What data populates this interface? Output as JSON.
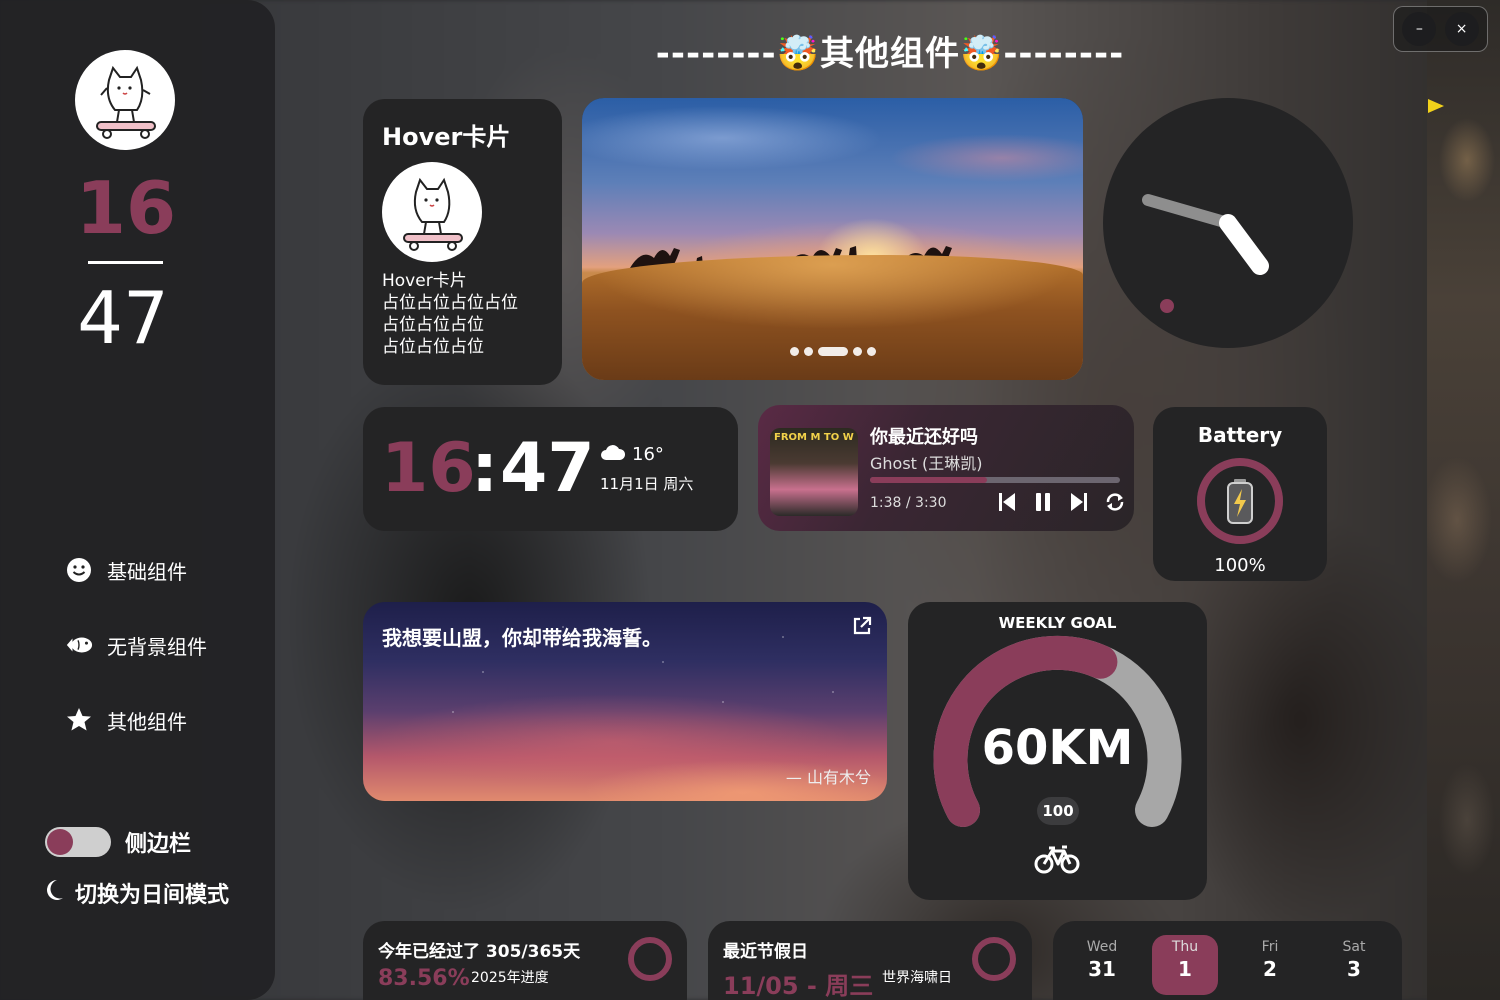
{
  "sidebar": {
    "hour": "16",
    "minute": "47",
    "nav": [
      {
        "label": "基础组件",
        "icon": "smile-icon"
      },
      {
        "label": "无背景组件",
        "icon": "fish-icon"
      },
      {
        "label": "其他组件",
        "icon": "star-icon"
      }
    ],
    "toggle_label": "侧边栏",
    "mode_label": "切换为日间模式"
  },
  "page": {
    "title": "--------🤯其他组件🤯--------"
  },
  "hover_card": {
    "title": "Hover卡片",
    "lines": [
      "Hover卡片",
      "占位占位占位占位",
      "占位占位占位",
      "占位占位占位"
    ]
  },
  "carousel": {
    "dots": 5,
    "active_dot": 2
  },
  "time_card": {
    "hour": "16",
    "separator": ":",
    "minute": "47",
    "temperature": "16°",
    "date": "11月1日 周六",
    "weather_icon": "cloud-icon"
  },
  "music": {
    "album_text": "FROM M TO W",
    "title": "你最近还好吗",
    "artist": "Ghost (王琳凯)",
    "time": "1:38 / 3:30",
    "progress": 0.467
  },
  "battery": {
    "title": "Battery",
    "percent": "100%",
    "level": 1.0
  },
  "quote": {
    "text": "我想要山盟，你却带给我海誓。",
    "author": "— 山有木兮"
  },
  "goal": {
    "title": "WEEKLY GOAL",
    "value": "60KM",
    "target": "100",
    "progress": 0.6,
    "icon": "bike-icon"
  },
  "year_progress": {
    "title": "今年已经过了 305/365天",
    "percent": "83.56%",
    "label": "2025年进度"
  },
  "holiday": {
    "title": "最近节假日",
    "date": "11/05 - 周三",
    "name": "世界海啸日"
  },
  "week": [
    {
      "name": "Wed",
      "day": "31",
      "active": false
    },
    {
      "name": "Thu",
      "day": "1",
      "active": true
    },
    {
      "name": "Fri",
      "day": "2",
      "active": false
    },
    {
      "name": "Sat",
      "day": "3",
      "active": false
    }
  ],
  "colors": {
    "accent": "#8a3d5a",
    "card": "#242425"
  },
  "window": {
    "minimize": "–",
    "close": "×"
  }
}
